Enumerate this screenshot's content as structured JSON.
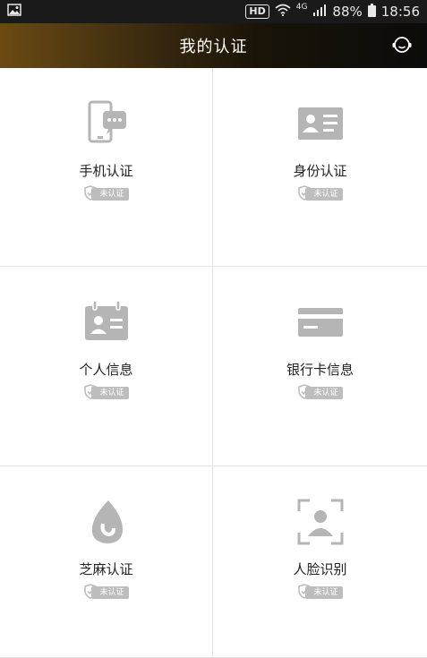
{
  "status_bar": {
    "network_badge": "HD",
    "network_type": "4G",
    "battery": "88%",
    "time": "18:56"
  },
  "header": {
    "title": "我的认证",
    "service_icon": "customer-service-icon"
  },
  "cards": [
    {
      "label": "手机认证",
      "status": "未认证",
      "icon": "phone-chat-icon"
    },
    {
      "label": "身份认证",
      "status": "未认证",
      "icon": "id-card-icon"
    },
    {
      "label": "个人信息",
      "status": "未认证",
      "icon": "contact-card-icon"
    },
    {
      "label": "银行卡信息",
      "status": "未认证",
      "icon": "bank-card-icon"
    },
    {
      "label": "芝麻认证",
      "status": "未认证",
      "icon": "sesame-drop-icon"
    },
    {
      "label": "人脸识别",
      "status": "未认证",
      "icon": "face-scan-icon"
    }
  ],
  "colors": {
    "icon_gray": "#b5b5b5",
    "status_gray": "#bdbdbd",
    "header_gold": "#6b4a12",
    "header_dark": "#0b0b0b"
  }
}
